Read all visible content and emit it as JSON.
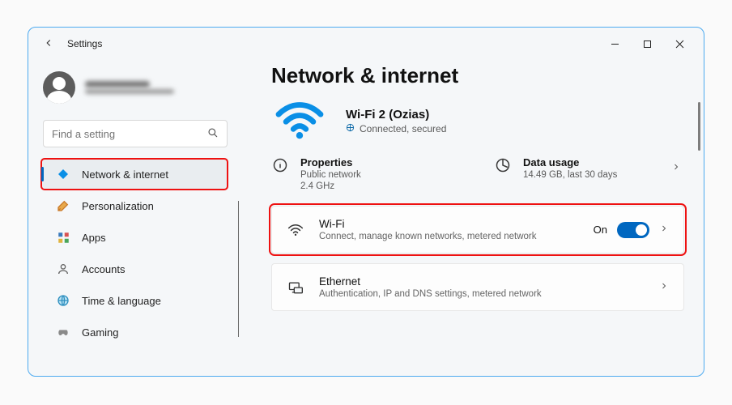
{
  "titlebar": {
    "app_name": "Settings"
  },
  "account": {
    "name_blur": true
  },
  "search": {
    "placeholder": "Find a setting"
  },
  "sidebar": {
    "items": [
      {
        "id": "network",
        "label": "Network & internet",
        "icon": "wifi-diamond",
        "active": true
      },
      {
        "id": "personalization",
        "label": "Personalization",
        "icon": "brush"
      },
      {
        "id": "apps",
        "label": "Apps",
        "icon": "grid"
      },
      {
        "id": "accounts",
        "label": "Accounts",
        "icon": "person"
      },
      {
        "id": "time",
        "label": "Time & language",
        "icon": "globe-clock"
      },
      {
        "id": "gaming",
        "label": "Gaming",
        "icon": "gamepad"
      }
    ]
  },
  "main": {
    "page_title": "Network & internet",
    "connection": {
      "name": "Wi-Fi 2 (Ozias)",
      "status": "Connected, secured"
    },
    "properties": {
      "title": "Properties",
      "line1": "Public network",
      "line2": "2.4 GHz"
    },
    "data_usage": {
      "title": "Data usage",
      "line1": "14.49 GB, last 30 days"
    },
    "wifi_panel": {
      "title": "Wi-Fi",
      "sub": "Connect, manage known networks, metered network",
      "toggle_label": "On"
    },
    "ethernet_panel": {
      "title": "Ethernet",
      "sub": "Authentication, IP and DNS settings, metered network"
    }
  }
}
